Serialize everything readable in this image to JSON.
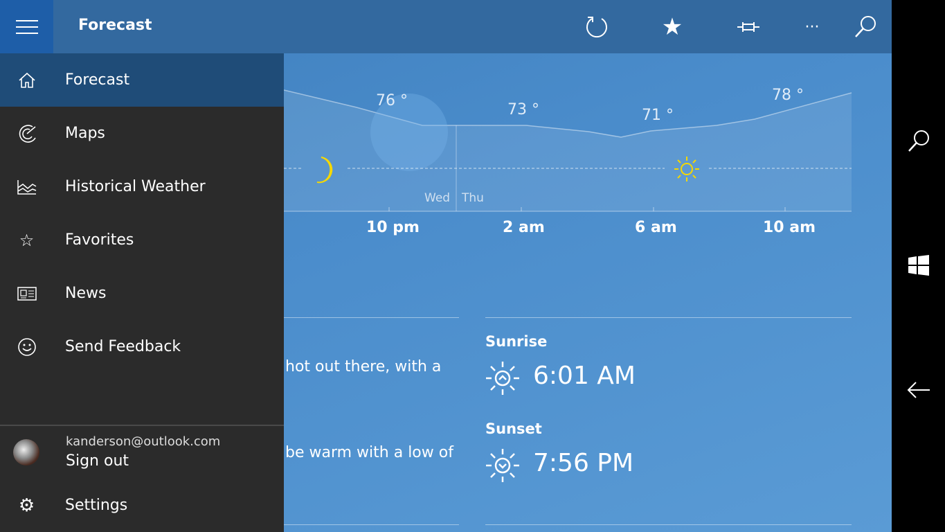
{
  "header": {
    "title": "Forecast",
    "icons": [
      "hamburger-icon",
      "refresh-icon",
      "star-icon",
      "pin-icon",
      "more-icon",
      "search-icon"
    ]
  },
  "nav": {
    "items": [
      {
        "label": "Forecast",
        "icon": "home-icon",
        "active": true
      },
      {
        "label": "Maps",
        "icon": "radar-icon"
      },
      {
        "label": "Historical Weather",
        "icon": "chart-icon"
      },
      {
        "label": "Favorites",
        "icon": "favorites-icon"
      },
      {
        "label": "News",
        "icon": "news-icon"
      },
      {
        "label": "Send Feedback",
        "icon": "smiley-icon"
      }
    ],
    "account": {
      "email": "kanderson@outlook.com",
      "action": "Sign out"
    },
    "settings": "Settings"
  },
  "hourly": {
    "temps": [
      {
        "time": "10 pm",
        "temp": "76 °"
      },
      {
        "time": "2 am",
        "temp": "73 °"
      },
      {
        "time": "6 am",
        "temp": "71 °"
      },
      {
        "time": "10 am",
        "temp": "78 °"
      }
    ],
    "day_left": "Wed",
    "day_right": "Thu"
  },
  "summary": {
    "line1": "hot out there, with a",
    "line2": "be warm with a low of"
  },
  "sun": {
    "sunrise_label": "Sunrise",
    "sunrise": "6:01 AM",
    "sunset_label": "Sunset",
    "sunset": "7:56 PM"
  },
  "colors": {
    "accent": "#1e5ea8",
    "nav_bg": "#2b2b2b",
    "nav_active": "#1f4c78",
    "sun_yellow": "#f5d800"
  }
}
